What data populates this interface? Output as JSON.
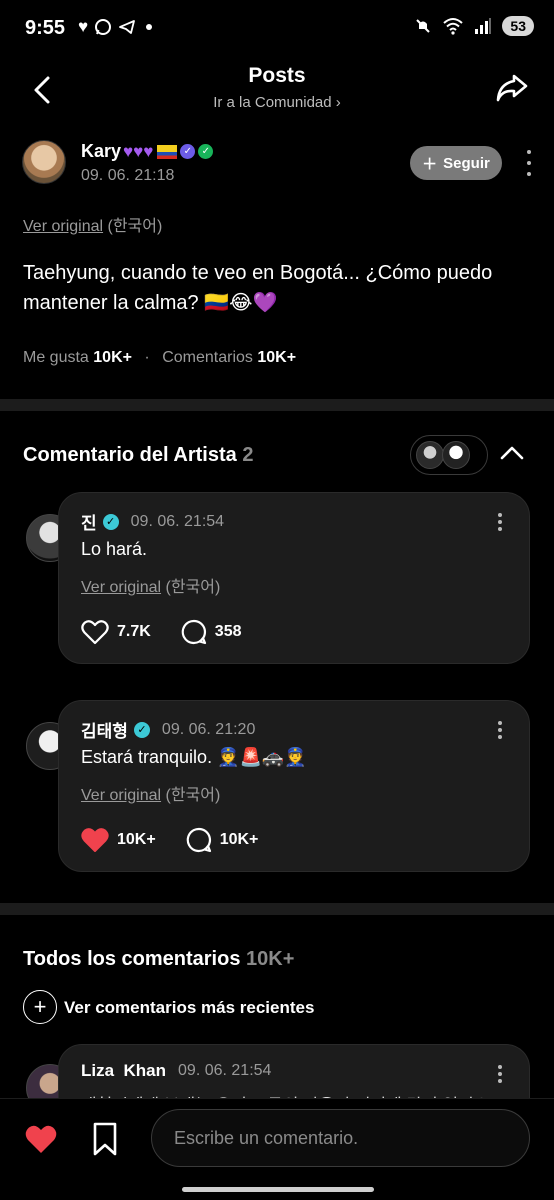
{
  "status_bar": {
    "time": "9:55",
    "battery": "53",
    "left_icons": [
      "heart-icon",
      "whatsapp-icon",
      "telegram-icon",
      "dot"
    ],
    "right_icons": [
      "mute-icon",
      "wifi-icon",
      "signal-icon",
      "battery-icon"
    ]
  },
  "header": {
    "title": "Posts",
    "subtitle": "Ir a la Comunidad"
  },
  "post": {
    "author_name": "Kary",
    "author_time": "09. 06. 21:18",
    "follow_label": "Seguir",
    "view_original": "Ver original",
    "original_lang": "(한국어)",
    "text_line1": "Taehyung, cuando te veo en Bogotá... ¿Cómo puedo",
    "text_line2": "mantener la calma? 🇨🇴😂💜",
    "likes_label": "Me gusta",
    "likes_count": "10K+",
    "comments_label": "Comentarios",
    "comments_count": "10K+"
  },
  "artist_section": {
    "title": "Comentario del Artista",
    "count": "2",
    "comments": [
      {
        "name": "진",
        "time": "09. 06. 21:54",
        "text": "Lo hará.",
        "view_original": "Ver original",
        "original_lang": "(한국어)",
        "likes": "7.7K",
        "replies": "358",
        "liked": false
      },
      {
        "name": "김태형",
        "time": "09. 06. 21:20",
        "text": "Estará tranquilo. 👮🚨🚓👮",
        "view_original": "Ver original",
        "original_lang": "(한국어)",
        "likes": "10K+",
        "replies": "10K+",
        "liked": true
      }
    ]
  },
  "all_comments": {
    "title": "Todos los comentarios",
    "count": "10K+",
    "recent_label": "Ver comentarios más recientes",
    "first_comment": {
      "name": "Liza  Khan",
      "time": "09. 06. 21:54",
      "text": "태형씨에게 보내는 우리 모두의 마음이 여기에 담겨 있어요"
    }
  },
  "bottom_bar": {
    "placeholder": "Escribe un comentario."
  },
  "colors": {
    "background": "#000000",
    "card": "#1c1c1c",
    "divider": "#1c1c1c",
    "muted_text": "#9a9a9a",
    "follow_button": "#7a7a7a",
    "like_red": "#f0424d",
    "verified": "#3cc9d6",
    "purple_heart": "#a55bf0"
  }
}
